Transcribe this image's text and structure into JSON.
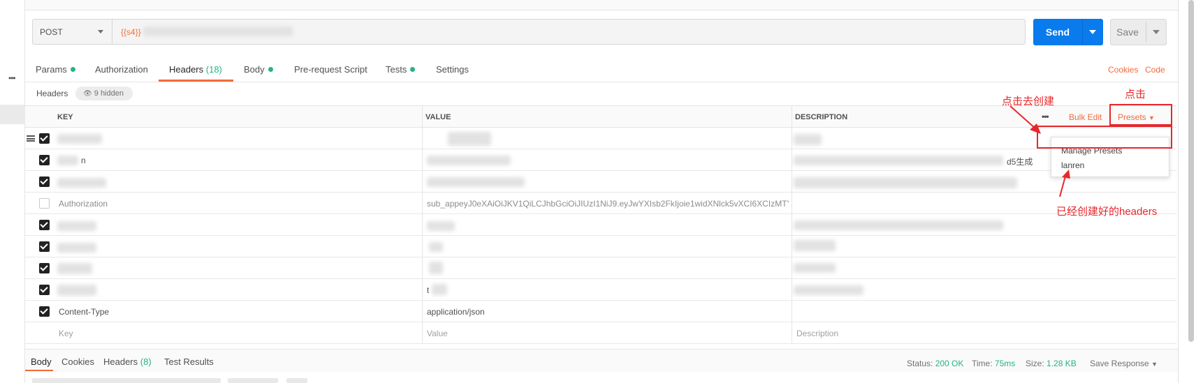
{
  "request": {
    "method": "POST",
    "url_visible": "{{s4}}",
    "send_label": "Send",
    "save_label": "Save"
  },
  "tabs": [
    {
      "label": "Params",
      "dot": true
    },
    {
      "label": "Authorization"
    },
    {
      "label": "Headers",
      "count": "(18)",
      "active": true
    },
    {
      "label": "Body",
      "dot": true
    },
    {
      "label": "Pre-request Script"
    },
    {
      "label": "Tests",
      "dot": true
    },
    {
      "label": "Settings"
    }
  ],
  "tab_links": {
    "cookies": "Cookies",
    "code": "Code"
  },
  "headers_section": {
    "label": "Headers",
    "hidden": "9 hidden"
  },
  "table": {
    "columns": {
      "key": "KEY",
      "value": "VALUE",
      "description": "DESCRIPTION"
    },
    "actions": {
      "more": "•••",
      "bulk_edit": "Bulk Edit",
      "presets": "Presets"
    },
    "rows": [
      {
        "checked": true
      },
      {
        "checked": true,
        "key_tail": "n",
        "desc_tail": "d5生成"
      },
      {
        "checked": true
      },
      {
        "checked": false,
        "key": "Authorization",
        "value": "sub_appeyJ0eXAiOiJKV1QiLCJhbGciOiJIUzI1NiJ9.eyJwYXIsb2FkIjoie1widXNlck5vXCI6XCIzMTY5N"
      },
      {
        "checked": true
      },
      {
        "checked": true
      },
      {
        "checked": true
      },
      {
        "checked": true,
        "value_head": "t"
      },
      {
        "checked": true,
        "key": "Content-Type",
        "value": "application/json"
      }
    ],
    "placeholder": {
      "key": "Key",
      "value": "Value",
      "description": "Description"
    }
  },
  "presets_menu": {
    "items": [
      "Manage Presets",
      "lanren"
    ]
  },
  "annotations": {
    "click_to_create": "点击去创建",
    "click": "点击",
    "created_headers": "已经创建好的headers"
  },
  "response": {
    "tabs": [
      {
        "label": "Body",
        "active": true
      },
      {
        "label": "Cookies"
      },
      {
        "label": "Headers",
        "count": "(8)"
      },
      {
        "label": "Test Results"
      }
    ],
    "status_label": "Status:",
    "status_value": "200 OK",
    "time_label": "Time:",
    "time_value": "75ms",
    "size_label": "Size:",
    "size_value": "1.28 KB",
    "save_response": "Save Response"
  },
  "colors": {
    "accent": "#f26b3a",
    "send_blue": "#097bed",
    "success": "#26b47f",
    "annotation_red": "#e8272b"
  }
}
